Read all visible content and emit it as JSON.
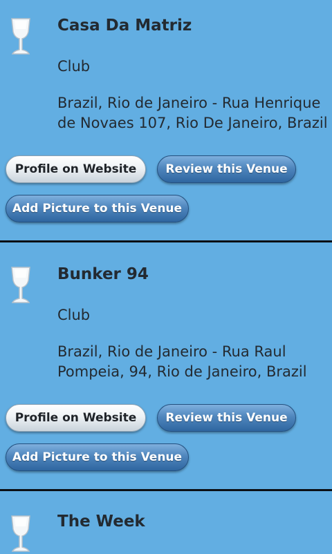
{
  "buttons": {
    "profile": "Profile on Website",
    "review": "Review this Venue",
    "add_picture": "Add Picture to this Venue"
  },
  "venues": [
    {
      "name": "Casa Da Matriz",
      "type": "Club",
      "address": "Brazil, Rio de Janeiro - Rua Henrique de Novaes 107, Rio De Janeiro, Brazil",
      "icon": "cocktail-glass-icon"
    },
    {
      "name": "Bunker 94",
      "type": "Club",
      "address": "Brazil, Rio de Janeiro - Rua Raul Pompeia, 94, Rio de Janeiro, Brazil",
      "icon": "cocktail-glass-icon"
    },
    {
      "name": "The Week",
      "icon": "cocktail-glass-icon"
    }
  ],
  "colors": {
    "background": "#62aee2",
    "divider": "#0b0f14",
    "text": "#232a31",
    "button_blue": "#4f86bd"
  }
}
